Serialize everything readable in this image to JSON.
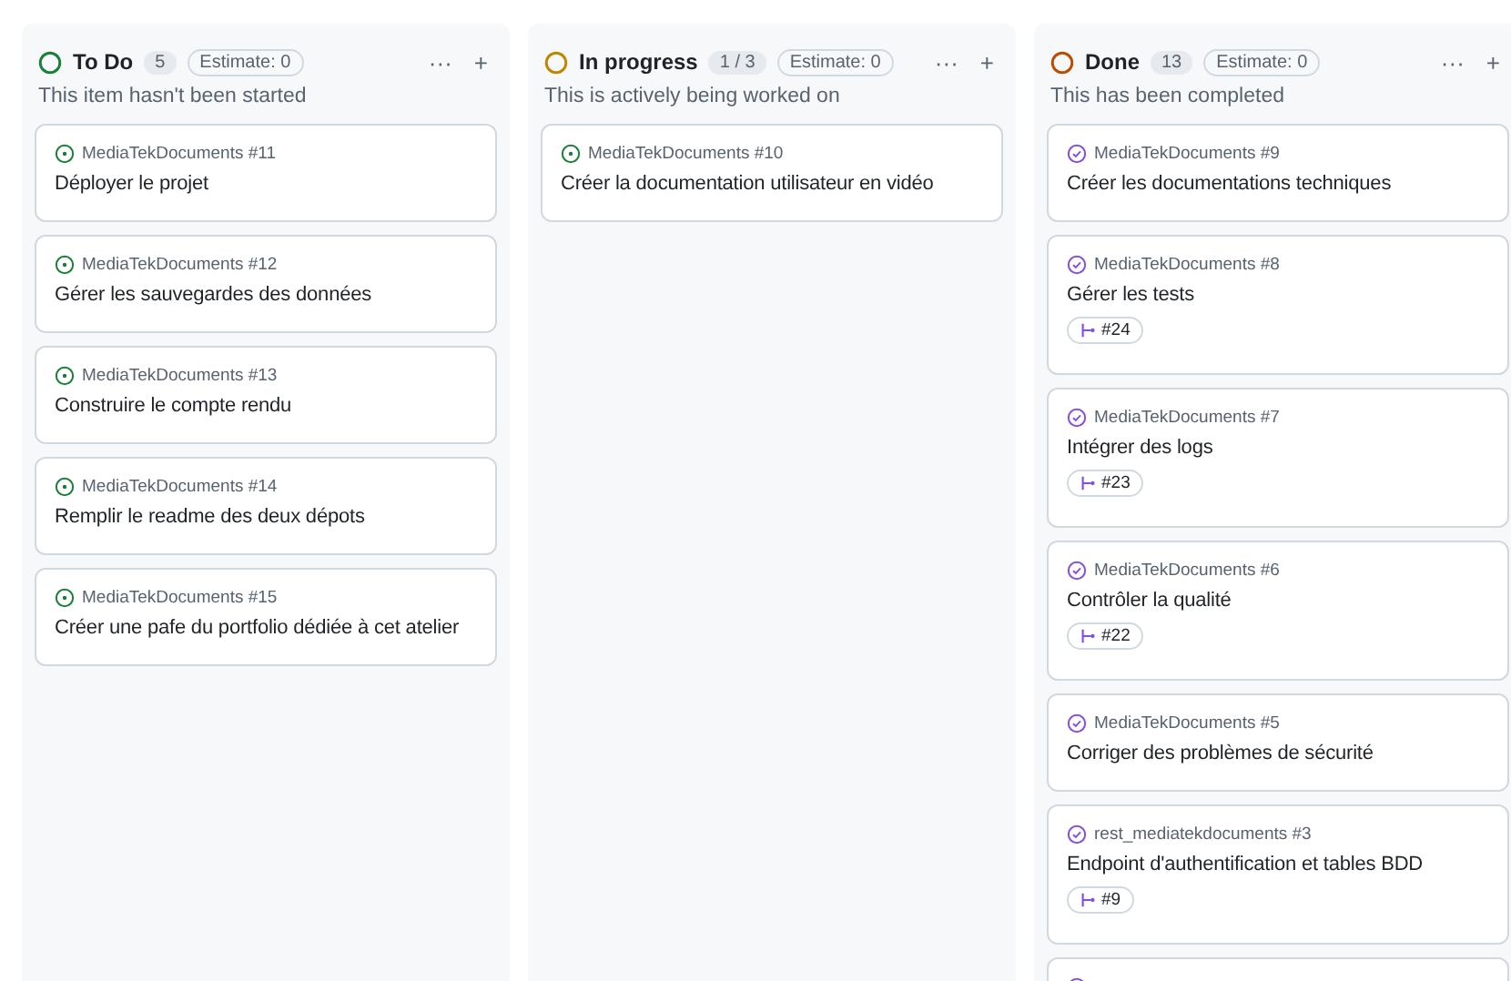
{
  "columns": [
    {
      "name": "To Do",
      "color": "#1a7f37",
      "count": "5",
      "estimate": "Estimate: 0",
      "description": "This item hasn't been started",
      "more": "···",
      "add": "+",
      "cards": [
        {
          "kind": "open",
          "repo": "MediaTekDocuments #11",
          "title": "Déployer le projet"
        },
        {
          "kind": "open",
          "repo": "MediaTekDocuments #12",
          "title": "Gérer les sauvegardes des données"
        },
        {
          "kind": "open",
          "repo": "MediaTekDocuments #13",
          "title": "Construire le compte rendu"
        },
        {
          "kind": "open",
          "repo": "MediaTekDocuments #14",
          "title": "Remplir le readme des deux dépots"
        },
        {
          "kind": "open",
          "repo": "MediaTekDocuments #15",
          "title": "Créer une pafe du portfolio dédiée à cet atelier"
        }
      ]
    },
    {
      "name": "In progress",
      "color": "#bf8700",
      "count": "1 / 3",
      "estimate": "Estimate: 0",
      "description": "This is actively being worked on",
      "more": "···",
      "add": "+",
      "cards": [
        {
          "kind": "open",
          "repo": "MediaTekDocuments #10",
          "title": "Créer la documentation utilisateur en vidéo"
        }
      ]
    },
    {
      "name": "Done",
      "color": "#bc4c00",
      "count": "13",
      "estimate": "Estimate: 0",
      "description": "This has been completed",
      "more": "···",
      "add": "+",
      "cards": [
        {
          "kind": "done",
          "repo": "MediaTekDocuments #9",
          "title": "Créer les documentations techniques"
        },
        {
          "kind": "done",
          "repo": "MediaTekDocuments #8",
          "title": "Gérer les tests",
          "pr": "#24"
        },
        {
          "kind": "done",
          "repo": "MediaTekDocuments #7",
          "title": "Intégrer des logs",
          "pr": "#23"
        },
        {
          "kind": "done",
          "repo": "MediaTekDocuments #6",
          "title": "Contrôler la qualité",
          "pr": "#22"
        },
        {
          "kind": "done",
          "repo": "MediaTekDocuments #5",
          "title": "Corriger des problèmes de sécurité"
        },
        {
          "kind": "done",
          "repo": "rest_mediatekdocuments #3",
          "title": "Endpoint d'authentification et tables BDD",
          "pr": "#9"
        },
        {
          "kind": "done"
        }
      ]
    }
  ]
}
